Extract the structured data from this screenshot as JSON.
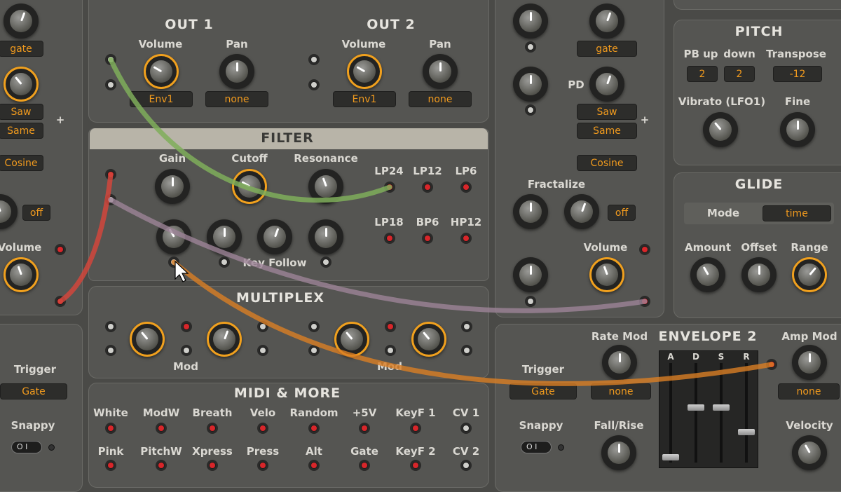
{
  "out1": {
    "title": "OUT 1",
    "volume": "Volume",
    "pan": "Pan",
    "volume_src": "Env1",
    "pan_src": "none"
  },
  "out2": {
    "title": "OUT 2",
    "volume": "Volume",
    "pan": "Pan",
    "volume_src": "Env1",
    "pan_src": "none"
  },
  "filter": {
    "title": "FILTER",
    "gain": "Gain",
    "cutoff": "Cutoff",
    "resonance": "Resonance",
    "key_follow": "Key Follow",
    "modes": [
      "LP24",
      "LP12",
      "LP6",
      "LP18",
      "BP6",
      "HP12"
    ]
  },
  "multiplex": {
    "title": "MULTIPLEX",
    "mod_left": "Mod",
    "mod_right": "Mod"
  },
  "midi": {
    "title": "MIDI & MORE",
    "row1": [
      "White",
      "ModW",
      "Breath",
      "Velo",
      "Random",
      "+5V",
      "KeyF 1",
      "CV 1"
    ],
    "row2": [
      "Pink",
      "PitchW",
      "Xpress",
      "Press",
      "Alt",
      "Gate",
      "KeyF 2",
      "CV 2"
    ]
  },
  "left_osc": {
    "gate": "gate",
    "wave": "Saw",
    "same": "Same",
    "shape": "Cosine",
    "off": "off",
    "volume": "Volume",
    "plus": "+"
  },
  "left_env": {
    "trigger": "Trigger",
    "trigger_val": "Gate",
    "snappy": "Snappy",
    "toggle": "O I"
  },
  "right_osc": {
    "gate": "gate",
    "pd": "PD",
    "wave": "Saw",
    "same": "Same",
    "shape": "Cosine",
    "fractalize": "Fractalize",
    "off": "off",
    "volume": "Volume",
    "plus": "+"
  },
  "pitch": {
    "title": "PITCH",
    "pb_up": "PB up",
    "down": "down",
    "transpose": "Transpose",
    "pb_up_val": "2",
    "down_val": "2",
    "transpose_val": "-12",
    "vibrato": "Vibrato (LFO1)",
    "fine": "Fine"
  },
  "glide": {
    "title": "GLIDE",
    "mode": "Mode",
    "mode_val": "time",
    "amount": "Amount",
    "offset": "Offset",
    "range": "Range"
  },
  "env2": {
    "title": "ENVELOPE 2",
    "trigger": "Trigger",
    "trigger_val": "Gate",
    "rate_mod": "Rate Mod",
    "rate_mod_val": "none",
    "snappy": "Snappy",
    "toggle": "O I",
    "fall_rise": "Fall/Rise",
    "amp_mod": "Amp Mod",
    "amp_mod_val": "none",
    "velocity": "Velocity",
    "adsr": [
      "A",
      "D",
      "S",
      "R"
    ],
    "levels": [
      0.05,
      0.55,
      0.55,
      0.3
    ]
  },
  "colors": {
    "accent": "#f09a1e",
    "wire_green": "#7fae5a",
    "wire_red": "#d2463c",
    "wire_purple": "#9c8397",
    "wire_orange": "#d97e24",
    "filter_bar": "#b8b4a8"
  }
}
